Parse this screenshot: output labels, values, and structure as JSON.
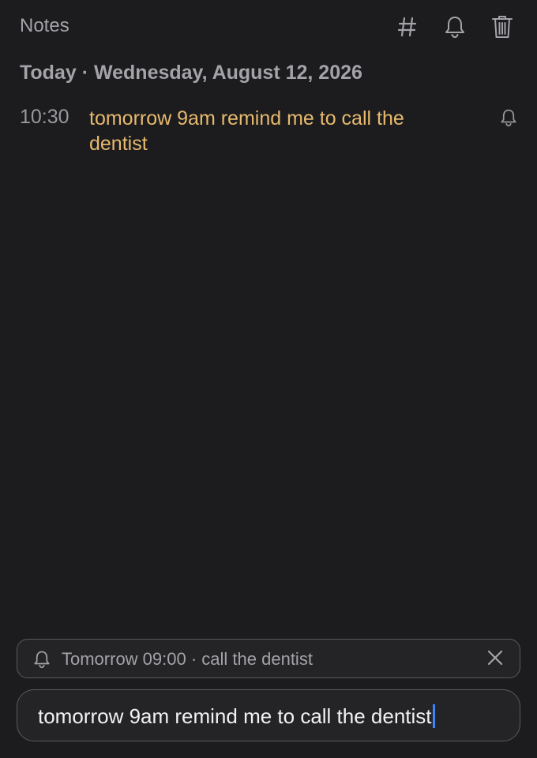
{
  "header": {
    "title": "Notes",
    "icons": [
      "hash-icon",
      "bell-icon",
      "trash-icon"
    ]
  },
  "day_heading": "Today · Wednesday, August 12, 2026",
  "notes": [
    {
      "time": "10:30",
      "text": "tomorrow 9am remind me to call the dentist",
      "has_reminder": true
    }
  ],
  "reminder_preview": {
    "text": "Tomorrow 09:00 · call the dentist"
  },
  "composer": {
    "value": "tomorrow 9am remind me to call the dentist"
  },
  "colors": {
    "background": "#1c1c1e",
    "note_text": "#e7b96e",
    "muted": "#a3a3a8",
    "caret": "#3a86ff"
  }
}
